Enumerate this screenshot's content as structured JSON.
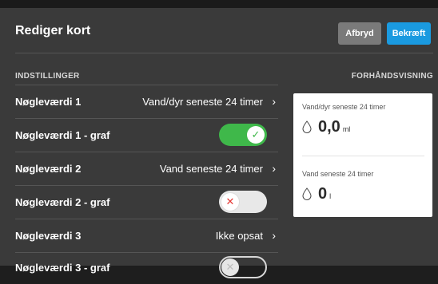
{
  "dialog": {
    "title": "Rediger kort",
    "cancel_label": "Afbryd",
    "confirm_label": "Bekræft"
  },
  "settings": {
    "heading": "INDSTILLINGER",
    "rows": [
      {
        "label": "Nøgleværdi 1",
        "value": "Vand/dyr seneste 24 timer"
      },
      {
        "label": "Nøgleværdi 1 - graf",
        "toggle": true
      },
      {
        "label": "Nøgleværdi 2",
        "value": "Vand seneste 24 timer"
      },
      {
        "label": "Nøgleværdi 2 - graf",
        "toggle": false
      },
      {
        "label": "Nøgleværdi 3",
        "value": "Ikke opsat"
      },
      {
        "label": "Nøgleværdi 3 - graf",
        "toggle": false
      }
    ]
  },
  "preview": {
    "heading": "FORHÅNDSVISNING",
    "items": [
      {
        "label": "Vand/dyr seneste 24 timer",
        "value": "0,0",
        "unit": "ml",
        "icon": "water-drop-icon"
      },
      {
        "label": "Vand seneste 24 timer",
        "value": "0",
        "unit": "l",
        "icon": "water-drop-icon"
      }
    ]
  },
  "icons": {
    "chevron": "›",
    "check": "✓",
    "cross": "✕"
  },
  "colors": {
    "background": "#3a3a3a",
    "confirm": "#1a9ae0",
    "cancel": "#7a7a7a",
    "toggle_on": "#3fb84a",
    "toggle_off_mark": "#e53935"
  }
}
